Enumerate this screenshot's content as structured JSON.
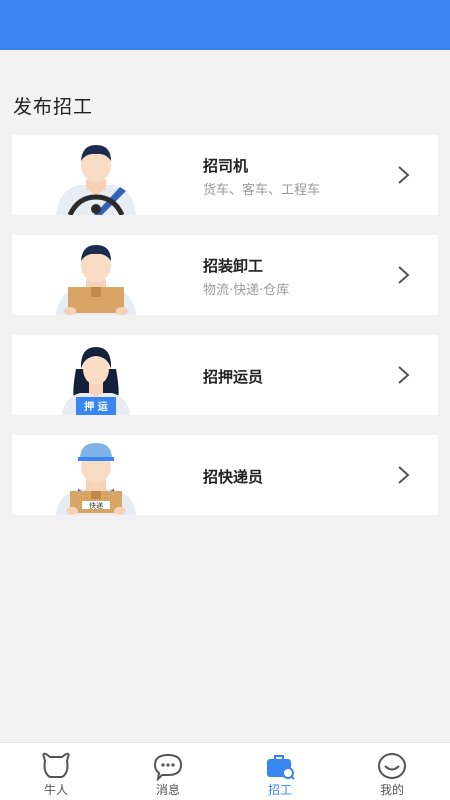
{
  "header": {
    "title": "发布招工"
  },
  "cards": [
    {
      "title": "招司机",
      "subtitle": "货车、客车、工程车"
    },
    {
      "title": "招装卸工",
      "subtitle": "物流·快递·仓库"
    },
    {
      "title": "招押运员",
      "badge": "押 运"
    },
    {
      "title": "招快递员",
      "badge": "快递"
    }
  ],
  "tabbar": {
    "items": [
      {
        "label": "牛人",
        "icon": "ox-face-icon"
      },
      {
        "label": "消息",
        "icon": "chat-bubble-icon"
      },
      {
        "label": "招工",
        "icon": "briefcase-search-icon",
        "active": true
      },
      {
        "label": "我的",
        "icon": "smile-face-icon"
      }
    ]
  },
  "colors": {
    "accent": "#3a86f0",
    "background": "#f2f2f2",
    "card": "#ffffff"
  }
}
